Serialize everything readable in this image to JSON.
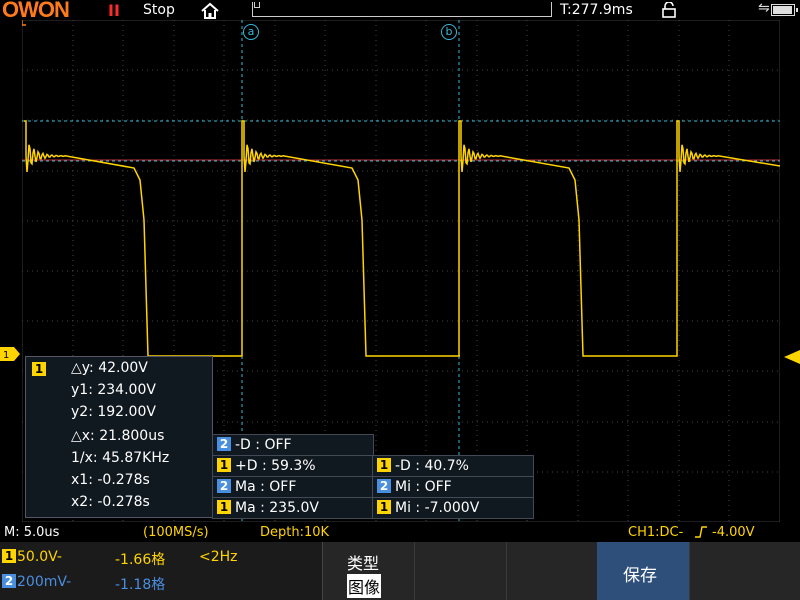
{
  "top": {
    "logo": "OWON",
    "run_icon": "II",
    "run_state": "Stop",
    "trigger_time": "T:277.9ms"
  },
  "cursors": {
    "a_label": "a",
    "b_label": "b"
  },
  "measure_panel": {
    "channel": "1",
    "dy": "△y: 42.00V",
    "y1": "y1: 234.00V",
    "y2": "y2: 192.00V",
    "dx": "△x: 21.800us",
    "inv_x": "1/x: 45.87KHz",
    "x1": "x1: -0.278s",
    "x2": "x2: -0.278s"
  },
  "overlay": [
    {
      "ch": "2",
      "text": "-D : OFF"
    },
    {
      "ch": "1",
      "text": "+D : 59.3%"
    },
    {
      "ch": "1",
      "text": "-D : 40.7%"
    },
    {
      "ch": "2",
      "text": "Ma : OFF"
    },
    {
      "ch": "2",
      "text": "Mi : OFF"
    },
    {
      "ch": "1",
      "text": "Ma : 235.0V"
    },
    {
      "ch": "1",
      "text": "Mi : -7.000V"
    }
  ],
  "status": {
    "timebase": "M: 5.0us",
    "sample_rate": "(100MS/s)",
    "depth": "Depth:10K",
    "trigger": "CH1:DC-",
    "trigger_level": "-4.00V"
  },
  "bottom": {
    "ch1": {
      "num": "1",
      "scale": "50.0V-",
      "offset": "-1.66格",
      "freq": "<2Hz"
    },
    "ch2": {
      "num": "2",
      "scale": "200mV-",
      "offset": "-1.18格"
    },
    "type_label": "类型",
    "type_value": "图像",
    "save_label": "保存"
  },
  "colors": {
    "ch1": "#ffd400",
    "ch2": "#4a8ee0",
    "cursor": "#39b8d6",
    "ref_line": "#c03030",
    "brand": "#ff7a1c"
  }
}
